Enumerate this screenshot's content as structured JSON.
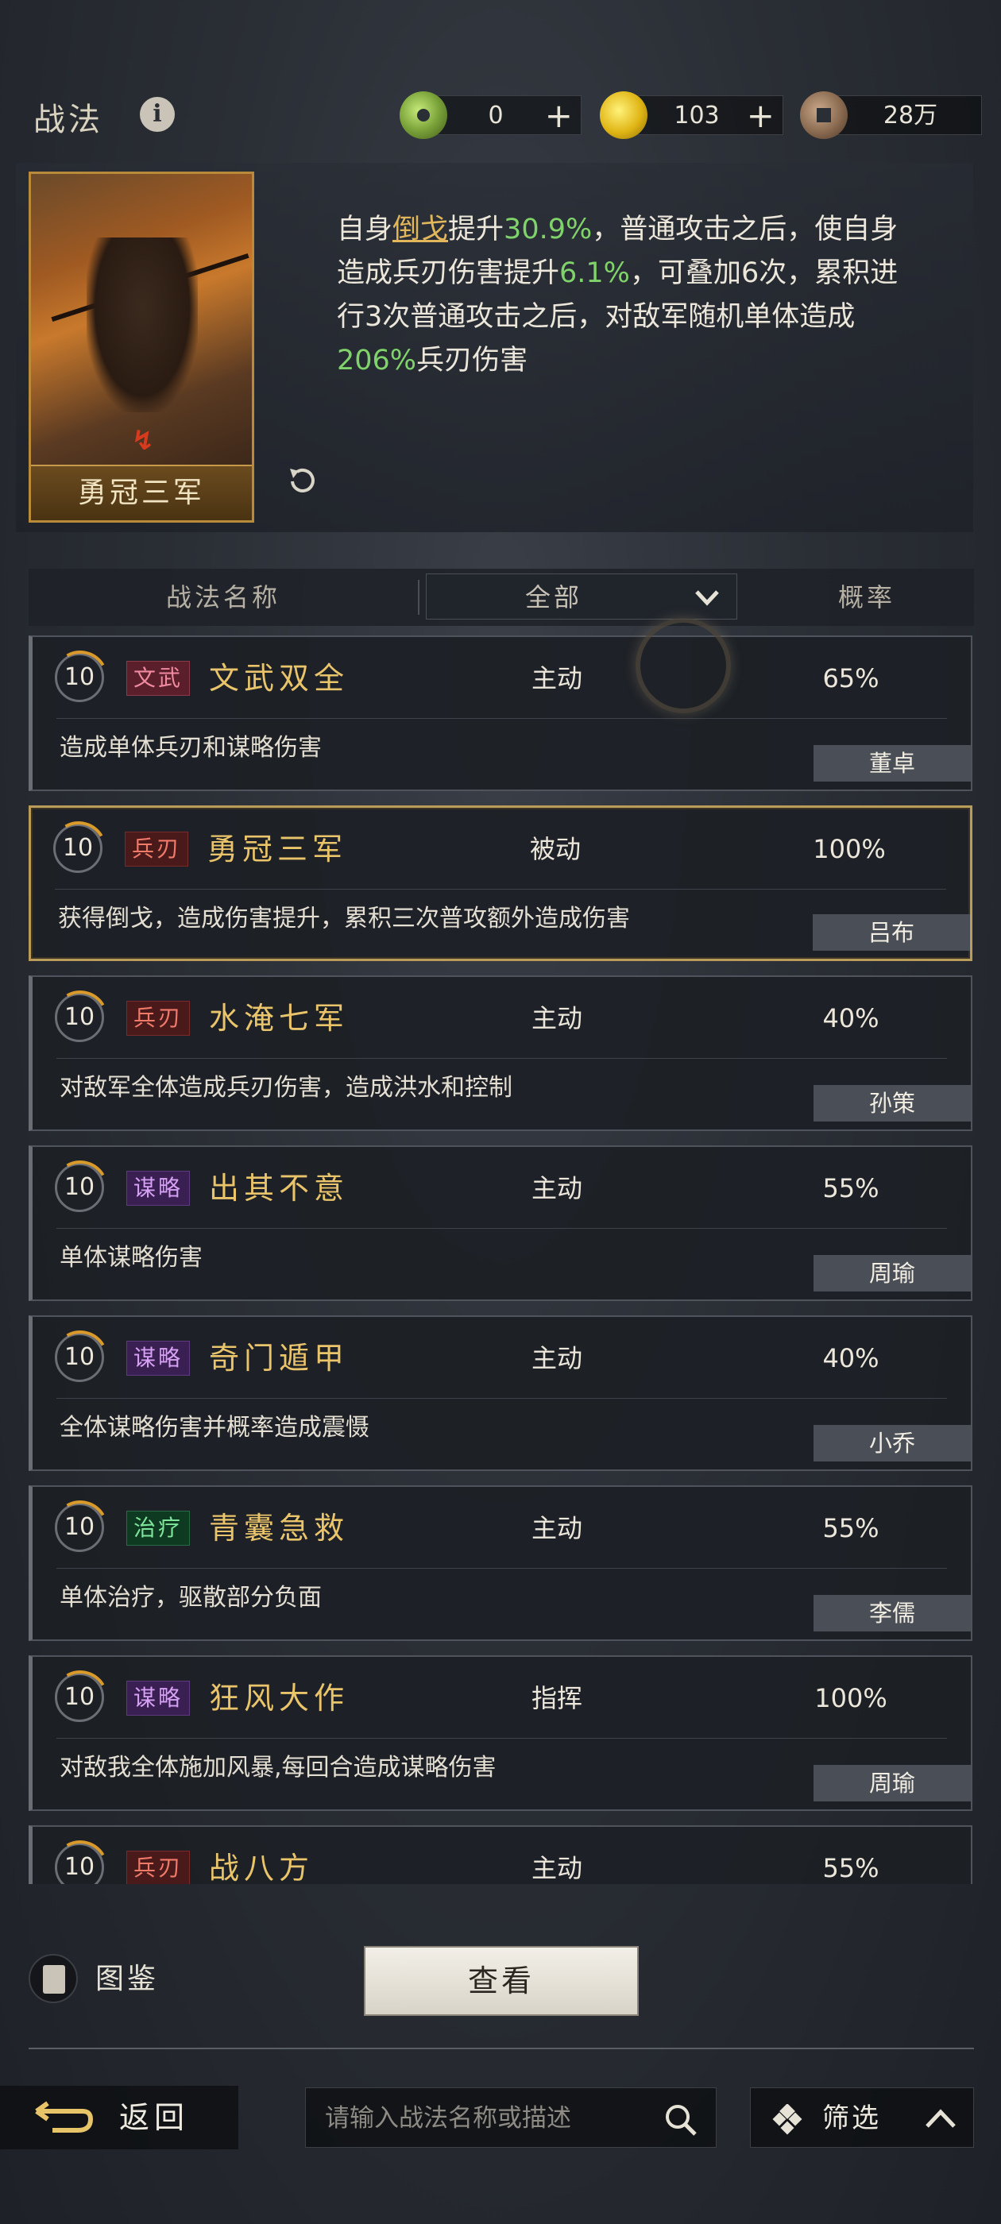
{
  "header": {
    "title": "战法",
    "resources": [
      {
        "name": "jade-coin",
        "value": "0",
        "has_plus": true
      },
      {
        "name": "gold-coin",
        "value": "103",
        "has_plus": true
      },
      {
        "name": "bronze-coin",
        "value": "28万",
        "has_plus": false
      }
    ]
  },
  "selected": {
    "card_name": "勇冠三军",
    "desc": {
      "p1": "自身",
      "h1": "倒戈",
      "p2": "提升",
      "g1": "30.9%",
      "p3": "，普通攻击之后，使自身造成兵刃伤害提升",
      "g2": "6.1%",
      "p4": "，可叠加6次，累积进行3次普通攻击之后，对敌军随机单体造成",
      "g3": "206%",
      "p5": "兵刃伤害"
    }
  },
  "columns": {
    "name": "战法名称",
    "filter": "全部",
    "rate": "概率"
  },
  "skills": [
    {
      "level": "10",
      "tag": "文武",
      "name": "文武双全",
      "type": "主动",
      "rate": "65%",
      "desc": "造成单体兵刃和谋略伤害",
      "owner": "董卓"
    },
    {
      "level": "10",
      "tag": "兵刃",
      "name": "勇冠三军",
      "type": "被动",
      "rate": "100%",
      "desc": "获得倒戈，造成伤害提升，累积三次普攻额外造成伤害",
      "owner": "吕布"
    },
    {
      "level": "10",
      "tag": "兵刃",
      "name": "水淹七军",
      "type": "主动",
      "rate": "40%",
      "desc": "对敌军全体造成兵刃伤害，造成洪水和控制",
      "owner": "孙策"
    },
    {
      "level": "10",
      "tag": "谋略",
      "name": "出其不意",
      "type": "主动",
      "rate": "55%",
      "desc": "单体谋略伤害",
      "owner": "周瑜"
    },
    {
      "level": "10",
      "tag": "谋略",
      "name": "奇门遁甲",
      "type": "主动",
      "rate": "40%",
      "desc": "全体谋略伤害并概率造成震慑",
      "owner": "小乔"
    },
    {
      "level": "10",
      "tag": "治疗",
      "name": "青囊急救",
      "type": "主动",
      "rate": "55%",
      "desc": "单体治疗，驱散部分负面",
      "owner": "李儒"
    },
    {
      "level": "10",
      "tag": "谋略",
      "name": "狂风大作",
      "type": "指挥",
      "rate": "100%",
      "desc": "对敌我全体施加风暴,每回合造成谋略伤害",
      "owner": "周瑜"
    },
    {
      "level": "10",
      "tag": "兵刃",
      "name": "战八方",
      "type": "主动",
      "rate": "55%",
      "desc": "",
      "owner": ""
    }
  ],
  "bottom": {
    "tujian": "图鉴",
    "view": "查看",
    "back": "返回",
    "search_placeholder": "请输入战法名称或描述",
    "filter": "筛选"
  },
  "colors": {
    "highlight_green": "#7fd36a",
    "highlight_gold": "#e2b65a",
    "skill_name": "#e9c46a"
  }
}
